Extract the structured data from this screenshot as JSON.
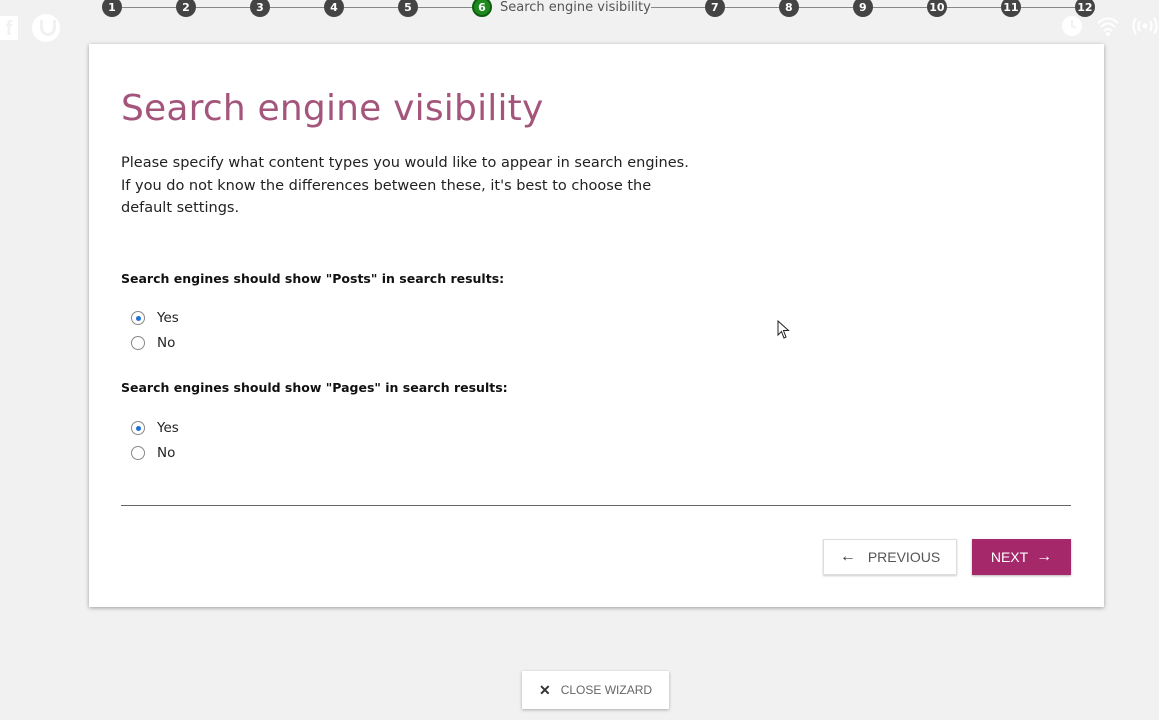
{
  "steps": [
    {
      "number": "1"
    },
    {
      "number": "2"
    },
    {
      "number": "3"
    },
    {
      "number": "4"
    },
    {
      "number": "5"
    },
    {
      "number": "6",
      "label": "Search engine visibility",
      "active": true
    },
    {
      "number": "7"
    },
    {
      "number": "8"
    },
    {
      "number": "9"
    },
    {
      "number": "10"
    },
    {
      "number": "11"
    },
    {
      "number": "12"
    }
  ],
  "card": {
    "title": "Search engine visibility",
    "intro": "Please specify what content types you would like to appear in search engines. If you do not know the differences between these, it's best to choose the default settings.",
    "questions": [
      {
        "label": "Search engines should show \"Posts\" in search results:",
        "options": [
          {
            "label": "Yes",
            "checked": true
          },
          {
            "label": "No",
            "checked": false
          }
        ]
      },
      {
        "label": "Search engines should show \"Pages\" in search results:",
        "options": [
          {
            "label": "Yes",
            "checked": true
          },
          {
            "label": "No",
            "checked": false
          }
        ]
      }
    ],
    "previous_label": "Previous",
    "next_label": "Next"
  },
  "close_wizard_label": "Close wizard",
  "colors": {
    "accent": "#a4286a",
    "title": "#a4557b",
    "active_step": "#1e8a1e",
    "radio_checked": "#1e6fd9"
  },
  "icons": [
    "facebook-icon",
    "tor-browser-icon",
    "clock-icon",
    "wifi-icon",
    "broadcast-icon",
    "arrow-left-icon",
    "arrow-right-icon",
    "close-icon",
    "mouse-cursor-icon"
  ]
}
